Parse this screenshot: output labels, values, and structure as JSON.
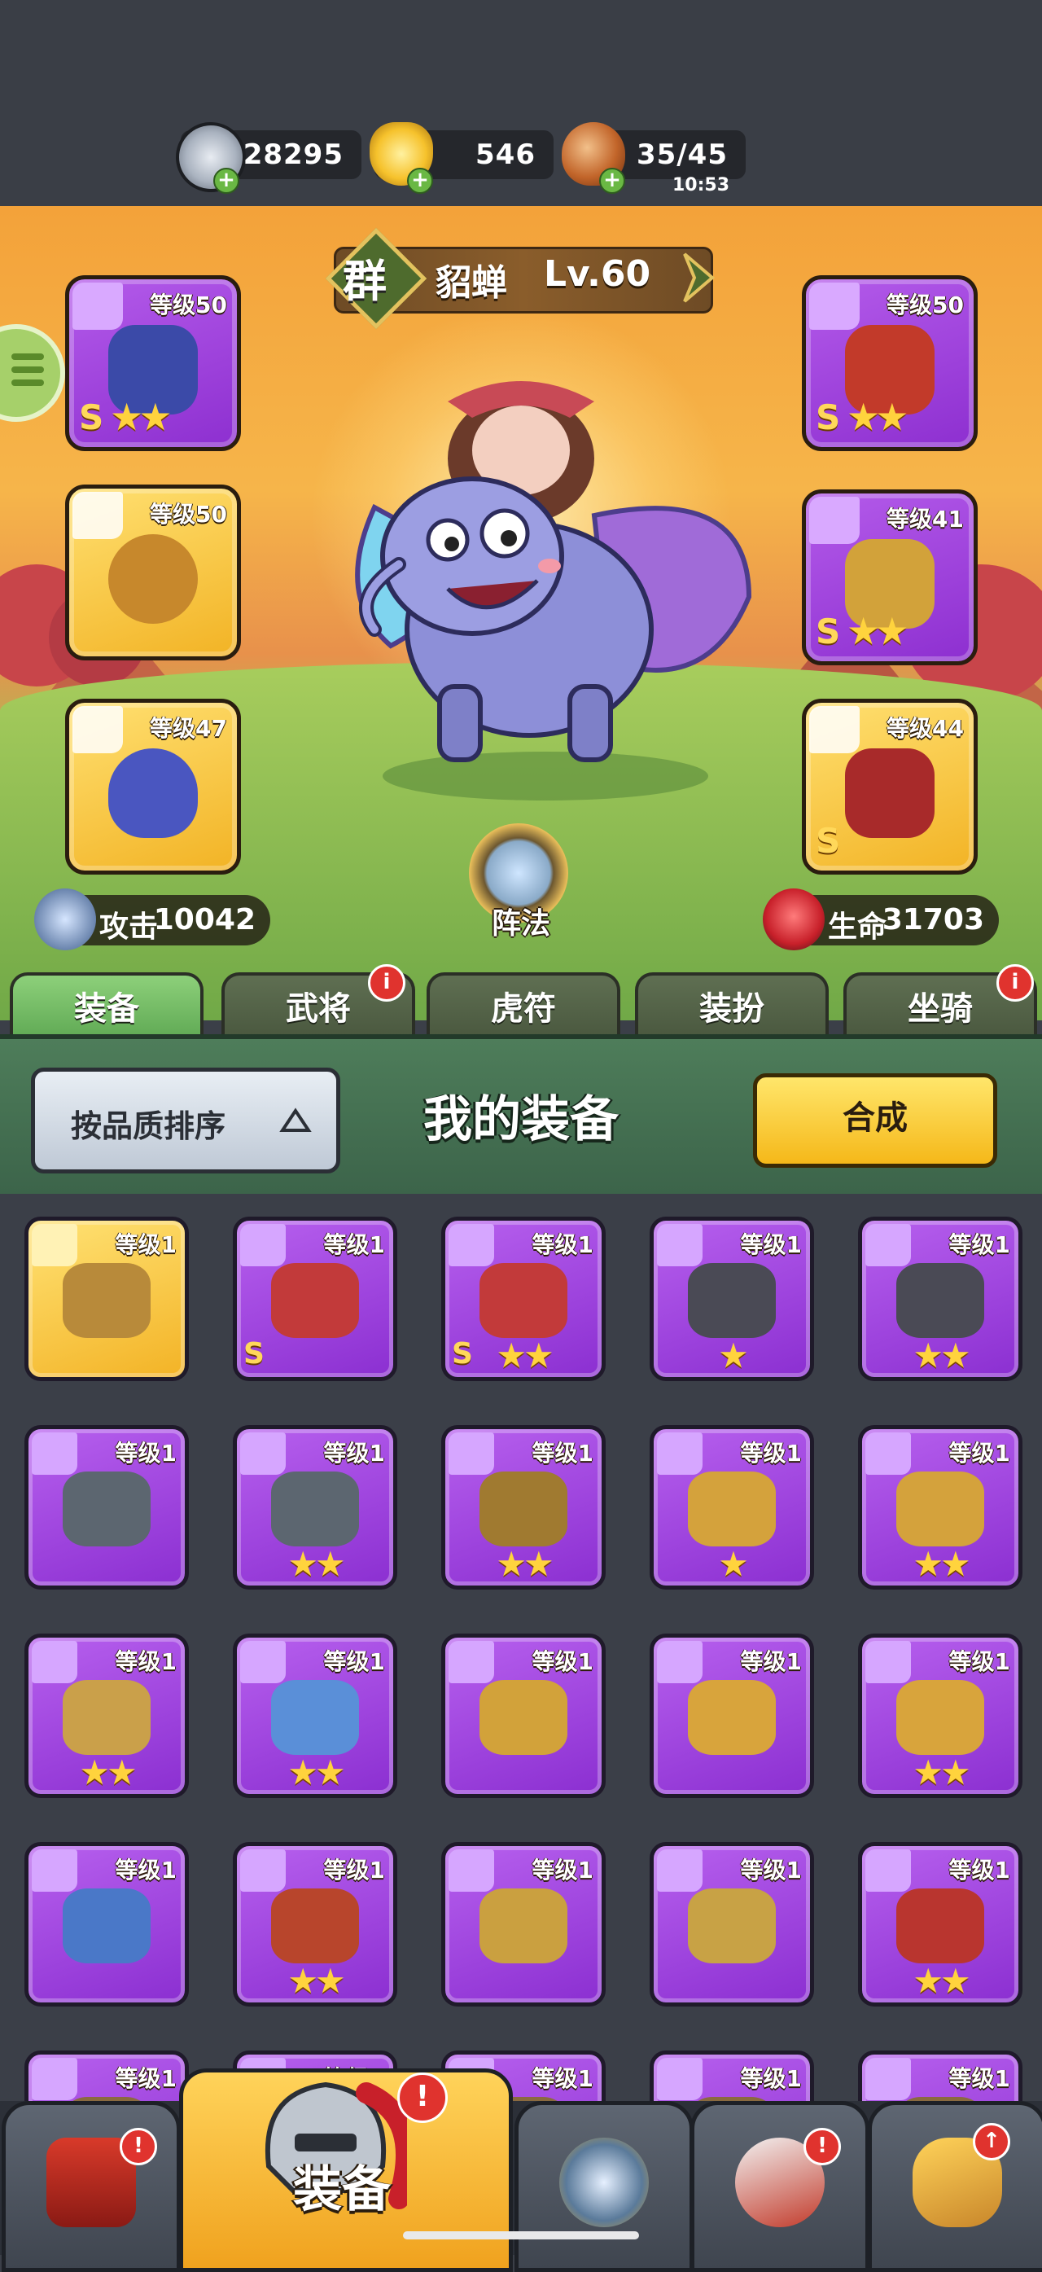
{
  "resources": {
    "silver": {
      "icon": "silver-coin-icon",
      "value": "28295"
    },
    "gold": {
      "icon": "gold-ingot-icon",
      "value": "546"
    },
    "stamina": {
      "icon": "meat-leg-icon",
      "value": "35/45",
      "timer": "10:53"
    }
  },
  "hero": {
    "faction": "群",
    "name": "貂蝉",
    "level": "Lv.60",
    "formation_label": "阵法",
    "attack_label": "攻击",
    "attack_value": "10042",
    "hp_label": "生命",
    "hp_value": "31703"
  },
  "slots": [
    {
      "type": "weapon",
      "icon": "sword-icon",
      "level": "等级50",
      "rarity": "purple",
      "s": "S",
      "stars": 2
    },
    {
      "type": "accessory",
      "icon": "medal-icon",
      "level": "等级50",
      "rarity": "gold",
      "s": "",
      "stars": 0
    },
    {
      "type": "helmet",
      "icon": "helmet-icon",
      "level": "等级47",
      "rarity": "gold",
      "s": "",
      "stars": 0
    },
    {
      "type": "armor",
      "icon": "armor-icon",
      "level": "等级50",
      "rarity": "purple",
      "s": "S",
      "stars": 2
    },
    {
      "type": "gauntlet",
      "icon": "gauntlet-icon",
      "level": "等级41",
      "rarity": "purple",
      "s": "S",
      "stars": 2
    },
    {
      "type": "boots",
      "icon": "boot-icon",
      "level": "等级44",
      "rarity": "gold",
      "s": "S",
      "stars": 0
    }
  ],
  "tabs": [
    {
      "label": "装备",
      "active": true,
      "badge": false
    },
    {
      "label": "武将",
      "active": false,
      "badge": true
    },
    {
      "label": "虎符",
      "active": false,
      "badge": false
    },
    {
      "label": "装扮",
      "active": false,
      "badge": false
    },
    {
      "label": "坐骑",
      "active": false,
      "badge": true
    }
  ],
  "badge_mark": "i",
  "panel": {
    "sort_label": "按品质排序",
    "title": "我的装备",
    "merge_label": "合成"
  },
  "items": [
    {
      "icon": "armor-icon",
      "level": "等级1",
      "rarity": "gold",
      "s": "",
      "stars": 0,
      "color": "#b88a3a"
    },
    {
      "icon": "sword-icon",
      "level": "等级1",
      "rarity": "purple",
      "s": "S",
      "stars": 0,
      "color": "#c23a3a"
    },
    {
      "icon": "sword-icon",
      "level": "等级1",
      "rarity": "purple",
      "s": "S",
      "stars": 2,
      "color": "#c23a3a"
    },
    {
      "icon": "sword-icon",
      "level": "等级1",
      "rarity": "purple",
      "s": "",
      "stars": 1,
      "color": "#4a4a55"
    },
    {
      "icon": "sword-icon",
      "level": "等级1",
      "rarity": "purple",
      "s": "",
      "stars": 2,
      "color": "#4a4a55"
    },
    {
      "icon": "sword-icon",
      "level": "等级1",
      "rarity": "purple",
      "s": "",
      "stars": 0,
      "color": "#5c6670"
    },
    {
      "icon": "sword-icon",
      "level": "等级1",
      "rarity": "purple",
      "s": "",
      "stars": 2,
      "color": "#5c6670"
    },
    {
      "icon": "armor-icon",
      "level": "等级1",
      "rarity": "purple",
      "s": "",
      "stars": 2,
      "color": "#a07a30"
    },
    {
      "icon": "armor-icon",
      "level": "等级1",
      "rarity": "purple",
      "s": "",
      "stars": 1,
      "color": "#d4a23c"
    },
    {
      "icon": "armor-icon",
      "level": "等级1",
      "rarity": "purple",
      "s": "",
      "stars": 2,
      "color": "#d4a23c"
    },
    {
      "icon": "medal-icon",
      "level": "等级1",
      "rarity": "purple",
      "s": "",
      "stars": 2,
      "color": "#caa04a"
    },
    {
      "icon": "medal-icon",
      "level": "等级1",
      "rarity": "purple",
      "s": "",
      "stars": 2,
      "color": "#5a8fd8"
    },
    {
      "icon": "medal-icon",
      "level": "等级1",
      "rarity": "purple",
      "s": "",
      "stars": 0,
      "color": "#d2a23a"
    },
    {
      "icon": "gauntlet-icon",
      "level": "等级1",
      "rarity": "purple",
      "s": "",
      "stars": 0,
      "color": "#d8a43c"
    },
    {
      "icon": "gauntlet-icon",
      "level": "等级1",
      "rarity": "purple",
      "s": "",
      "stars": 2,
      "color": "#d8a43c"
    },
    {
      "icon": "gauntlet-icon",
      "level": "等级1",
      "rarity": "purple",
      "s": "",
      "stars": 0,
      "color": "#4a78c8"
    },
    {
      "icon": "gauntlet-icon",
      "level": "等级1",
      "rarity": "purple",
      "s": "",
      "stars": 2,
      "color": "#b8452c"
    },
    {
      "icon": "gauntlet-icon",
      "level": "等级1",
      "rarity": "purple",
      "s": "",
      "stars": 0,
      "color": "#caa040"
    },
    {
      "icon": "gauntlet-icon",
      "level": "等级1",
      "rarity": "purple",
      "s": "",
      "stars": 0,
      "color": "#c8a245"
    },
    {
      "icon": "helmet-icon",
      "level": "等级1",
      "rarity": "purple",
      "s": "",
      "stars": 2,
      "color": "#b9352f"
    },
    {
      "icon": "helmet-icon",
      "level": "等级1",
      "rarity": "purple",
      "s": "",
      "stars": 0,
      "color": "#8a6a40"
    },
    {
      "icon": "helmet-icon",
      "level": "等级1",
      "rarity": "purple",
      "s": "",
      "stars": 0,
      "color": "#8a6a40"
    },
    {
      "icon": "boot-icon",
      "level": "等级1",
      "rarity": "purple",
      "s": "",
      "stars": 0,
      "color": "#8a6a40"
    },
    {
      "icon": "boot-icon",
      "level": "等级1",
      "rarity": "purple",
      "s": "",
      "stars": 0,
      "color": "#8a6a40"
    },
    {
      "icon": "boot-icon",
      "level": "等级1",
      "rarity": "purple",
      "s": "",
      "stars": 0,
      "color": "#8a6a40"
    }
  ],
  "nav": [
    {
      "icon": "palace-gate-icon",
      "badge": true,
      "active": false
    },
    {
      "icon": "helmet-icon",
      "label": "装备",
      "badge": true,
      "active": true
    },
    {
      "icon": "crossed-swords-icon",
      "badge": false,
      "active": false
    },
    {
      "icon": "horn-icon",
      "badge": true,
      "active": false
    },
    {
      "icon": "fist-upgrade-icon",
      "badge": false,
      "active": false
    }
  ],
  "colors": {
    "purple": "#9b40dc",
    "gold": "#f5bf2e",
    "panel_green": "#4e7d5a",
    "badge_red": "#e0332e"
  }
}
